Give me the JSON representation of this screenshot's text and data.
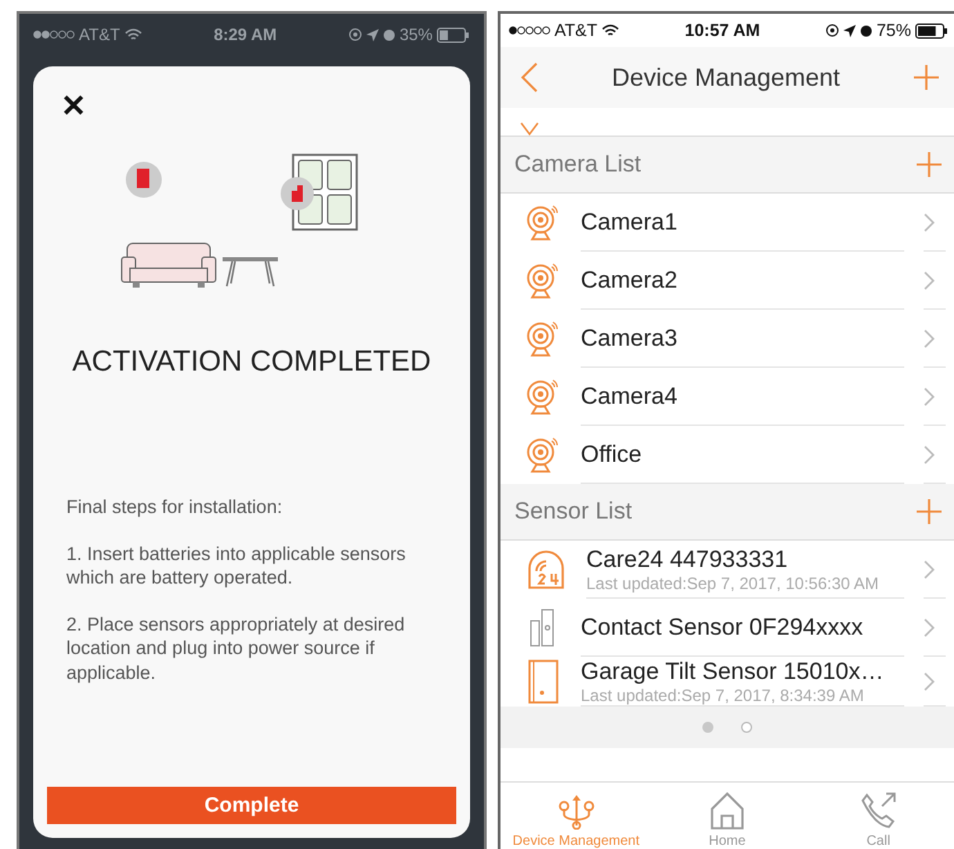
{
  "left_screen": {
    "status_bar": {
      "carrier": "AT&T",
      "time": "8:29 AM",
      "battery": "35%"
    },
    "modal": {
      "close": "✕",
      "title": "ACTIVATION COMPLETED",
      "instructions": [
        "Final steps for installation:",
        "1. Insert batteries into applicable sensors which are battery operated.",
        "2. Place sensors appropriately at desired location and plug into power source if applicable."
      ],
      "button": "Complete"
    }
  },
  "right_screen": {
    "status_bar": {
      "carrier": "AT&T",
      "time": "10:57 AM",
      "battery": "75%"
    },
    "nav_bar": {
      "title": "Device Management"
    },
    "sections": [
      {
        "title": "Camera List",
        "items": [
          {
            "kind": "camera",
            "name": "Camera1"
          },
          {
            "kind": "camera",
            "name": "Camera2"
          },
          {
            "kind": "camera",
            "name": "Camera3"
          },
          {
            "kind": "camera",
            "name": "Camera4"
          },
          {
            "kind": "camera",
            "name": "Office"
          }
        ]
      },
      {
        "title": "Sensor List",
        "items": [
          {
            "kind": "care24",
            "name": "Care24 447933331",
            "subtitle": "Last updated:Sep 7, 2017, 10:56:30 AM"
          },
          {
            "kind": "contact",
            "name": "Contact Sensor 0F294xxxx"
          },
          {
            "kind": "tilt",
            "name": "Garage Tilt Sensor 15010x…",
            "subtitle": "Last updated:Sep 7, 2017, 8:34:39 AM"
          }
        ]
      }
    ],
    "page_dots": [
      {
        "selected": true
      },
      {
        "selected": false
      }
    ],
    "tabs": [
      {
        "kind": "devices",
        "label": "Device Management",
        "selected": true
      },
      {
        "kind": "home",
        "label": "Home",
        "selected": false
      },
      {
        "kind": "call",
        "label": "Call",
        "selected": false
      }
    ]
  }
}
